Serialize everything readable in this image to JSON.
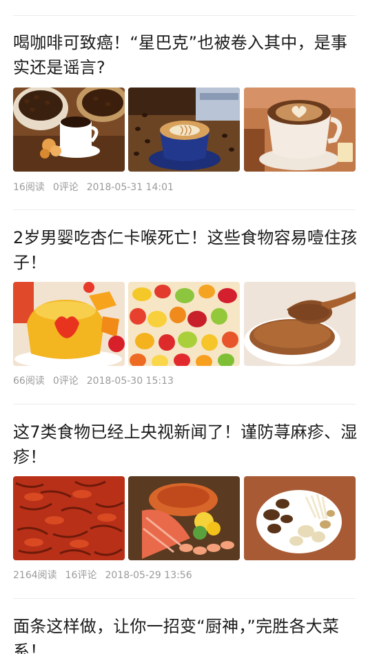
{
  "articles": [
    {
      "title": "喝咖啡可致癌！“星巴克”也被卷入其中，是事实还是谣言?",
      "reads": "16阅读",
      "comments": "0评论",
      "date": "2018-05-31 14:01",
      "images": [
        "coffee-beans-cup-photo",
        "latte-art-blue-cup-photo",
        "heart-cappuccino-photo"
      ]
    },
    {
      "title": "2岁男婴吃杏仁卡喉死亡！这些食物容易噎住孩子！",
      "reads": "66阅读",
      "comments": "0评论",
      "date": "2018-05-30 15:13",
      "images": [
        "jelly-dessert-photo",
        "gummy-candies-photo",
        "chocolate-spoon-photo"
      ]
    },
    {
      "title": "这7类食物已经上央视新闻了！谨防荨麻疹、湿疹！",
      "reads": "2164阅读",
      "comments": "16评论",
      "date": "2018-05-29 13:56",
      "images": [
        "crayfish-pile-photo",
        "seafood-platter-photo",
        "mushroom-plate-photo"
      ]
    },
    {
      "title": "面条这样做，让你一招变“厨神，”完胜各大菜系！"
    }
  ]
}
